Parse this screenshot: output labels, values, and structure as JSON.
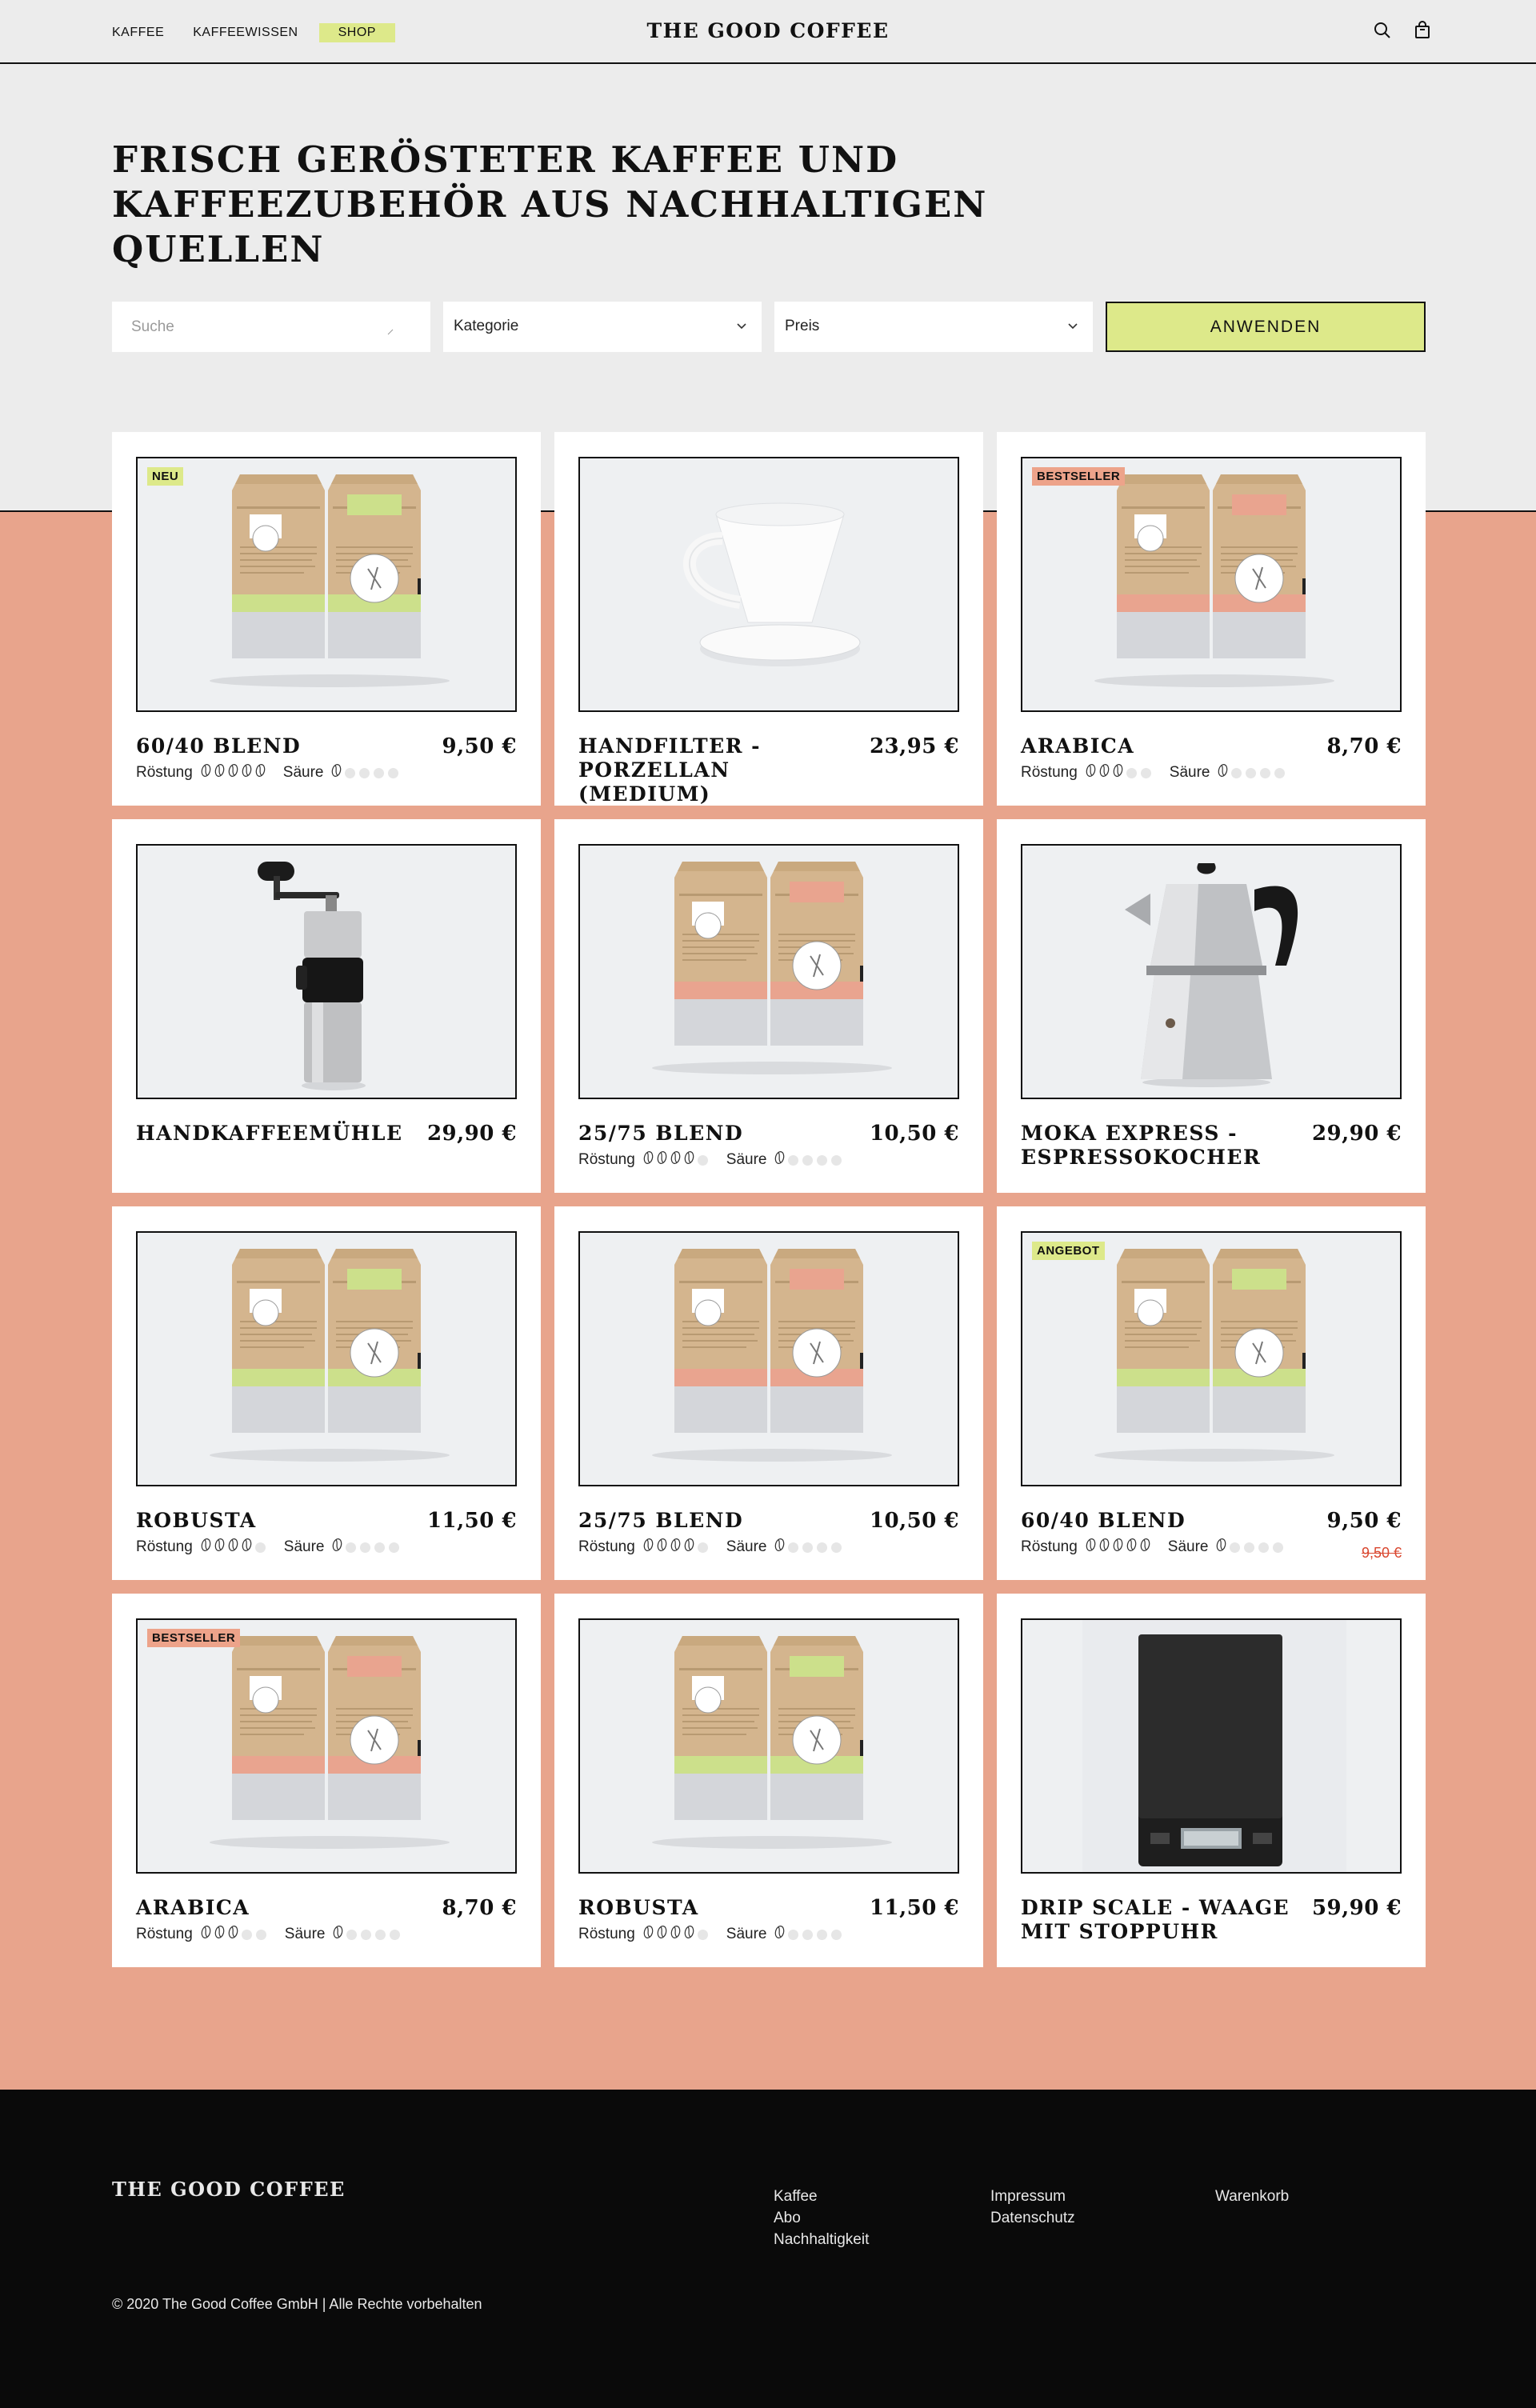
{
  "header": {
    "nav": [
      {
        "label": "KAFFEE",
        "active": false
      },
      {
        "label": "KAFFEEWISSEN",
        "active": false
      },
      {
        "label": "SHOP",
        "active": true
      }
    ],
    "logo": "THE GOOD COFFEE",
    "icons": [
      "search-icon",
      "cart-icon"
    ]
  },
  "hero": {
    "title": "FRISCH GERÖSTETER KAFFEE UND\nKAFFEEZUBEHÖR AUS NACHHALTIGEN QUELLEN"
  },
  "filters": {
    "search_placeholder": "Suche",
    "category_label": "Kategorie",
    "price_label": "Preis",
    "apply_label": "ANWENDEN"
  },
  "labels": {
    "roast": "Röstung",
    "acidity": "Säure"
  },
  "colors": {
    "accent_green": "#dde98a",
    "peach": "#e8a48c",
    "sale_red": "#d9462e",
    "badge_salmon": "#eda38a"
  },
  "products": [
    {
      "name": "60/40 BLEND",
      "price": "9,50 €",
      "badge": "NEU",
      "badge_color": "#dde98a",
      "image": "coffee-bags-green",
      "roast": 5,
      "acidity": 1
    },
    {
      "name": "HANDFILTER - PORZELLAN (MEDIUM)",
      "price": "23,95 €",
      "image": "porcelain-dripper"
    },
    {
      "name": "ARABICA",
      "price": "8,70 €",
      "badge": "BESTSELLER",
      "badge_color": "#eda38a",
      "image": "coffee-bags-salmon",
      "roast": 3,
      "acidity": 1
    },
    {
      "name": "HANDKAFFEEMÜHLE",
      "price": "29,90 €",
      "image": "hand-grinder"
    },
    {
      "name": "25/75 BLEND",
      "price": "10,50 €",
      "image": "coffee-bags-salmon",
      "roast": 4,
      "acidity": 1
    },
    {
      "name": "MOKA EXPRESS - ESPRESSOKOCHER",
      "price": "29,90 €",
      "image": "moka-pot"
    },
    {
      "name": "ROBUSTA",
      "price": "11,50 €",
      "image": "coffee-bags-green",
      "roast": 4,
      "acidity": 1
    },
    {
      "name": "25/75 BLEND",
      "price": "10,50 €",
      "image": "coffee-bags-salmon",
      "roast": 4,
      "acidity": 1
    },
    {
      "name": "60/40 BLEND",
      "price": "9,50 €",
      "old_price": "9,50 €",
      "badge": "ANGEBOT",
      "badge_color": "#dde98a",
      "image": "coffee-bags-green",
      "roast": 5,
      "acidity": 1
    },
    {
      "name": "ARABICA",
      "price": "8,70 €",
      "badge": "BESTSELLER",
      "badge_color": "#eda38a",
      "image": "coffee-bags-salmon",
      "roast": 3,
      "acidity": 1
    },
    {
      "name": "ROBUSTA",
      "price": "11,50 €",
      "image": "coffee-bags-green",
      "roast": 4,
      "acidity": 1
    },
    {
      "name": "DRIP SCALE - WAAGE MIT STOPPUHR",
      "price": "59,90 €",
      "image": "drip-scale"
    }
  ],
  "footer": {
    "logo": "THE GOOD COFFEE",
    "col1": [
      "Kaffee",
      "Abo",
      "Nachhaltigkeit"
    ],
    "col2": [
      "Impressum",
      "Datenschutz"
    ],
    "col3": [
      "Warenkorb"
    ],
    "copyright": "© 2020 The Good Coffee GmbH | Alle Rechte vorbehalten"
  }
}
